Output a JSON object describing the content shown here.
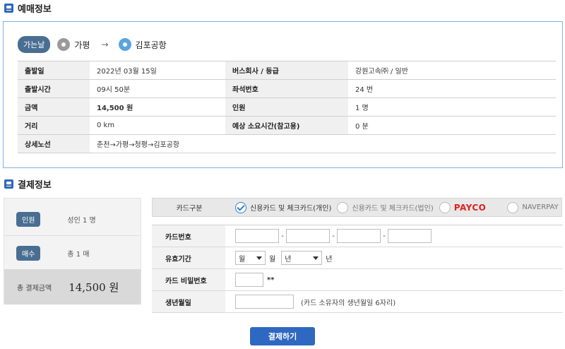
{
  "booking_section": {
    "title": "예매정보"
  },
  "route": {
    "direction_badge": "가는날",
    "origin": "가평",
    "arrow": "→",
    "destination": "김포공항"
  },
  "info_rows": [
    {
      "l1": "출발일",
      "v1": "2022년 03월 15일",
      "l2": "버스회사 / 등급",
      "v2": "강원고속㈜ / 일반"
    },
    {
      "l1": "출발시간",
      "v1": "09시 50분",
      "l2": "좌석번호",
      "v2": "24 번"
    },
    {
      "l1": "금액",
      "v1": "14,500 원",
      "l2": "인원",
      "v2": "1 명"
    },
    {
      "l1": "거리",
      "v1": "0 km",
      "l2": "예상 소요시간(참고용)",
      "v2": "0 분"
    },
    {
      "l1": "상세노선",
      "v1": "춘천→가평→청평→김포공항"
    }
  ],
  "payment_section": {
    "title": "결제정보"
  },
  "summary": {
    "people_badge": "인원",
    "people_value": "성인 1 명",
    "count_badge": "매수",
    "count_value": "총 1 매",
    "total_label": "총 결제금액",
    "total_value": "14,500 원"
  },
  "card_type": {
    "label": "카드구분",
    "options": [
      "신용카드 및 체크카드(개인)",
      "신용카드 및 체크카드(법인)",
      "PAYCO",
      "NAVERPAY"
    ],
    "selected_index": 0
  },
  "form": {
    "card_number_label": "카드번호",
    "expiry_label": "유효기간",
    "month_select": "월",
    "month_unit": "월",
    "year_select": "년",
    "year_unit": "년",
    "password_label": "카드 비밀번호",
    "password_suffix": "**",
    "birth_label": "생년월일",
    "birth_note": "(카드 소유자의 생년월일 6자리)"
  },
  "pay_button": "결제하기",
  "colors": {
    "accent": "#2f68c0",
    "badge": "#4a6e92",
    "payco": "#e02020",
    "border_blue": "#7fb2e3"
  }
}
